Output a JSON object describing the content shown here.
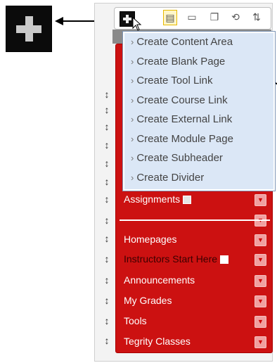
{
  "toolbar": {
    "add_menu_icon": "plus-icon",
    "icons": [
      "list-icon",
      "folder-icon",
      "copy-icon",
      "refresh-icon",
      "sort-icon"
    ]
  },
  "dropdown": {
    "items": [
      "Create Content Area",
      "Create Blank Page",
      "Create Tool Link",
      "Create Course Link",
      "Create External Link",
      "Create Module Page",
      "Create Subheader",
      "Create Divider"
    ]
  },
  "menu": {
    "items": [
      "Assignments",
      "Homepages",
      "Instructors Start Here",
      "Announcements",
      "My Grades",
      "Tools",
      "Tegrity Classes"
    ]
  },
  "colors": {
    "menu_red": "#cc1111",
    "dropdown_bg": "#dbe7f6",
    "toolbar_highlight": "#fff6c8"
  }
}
